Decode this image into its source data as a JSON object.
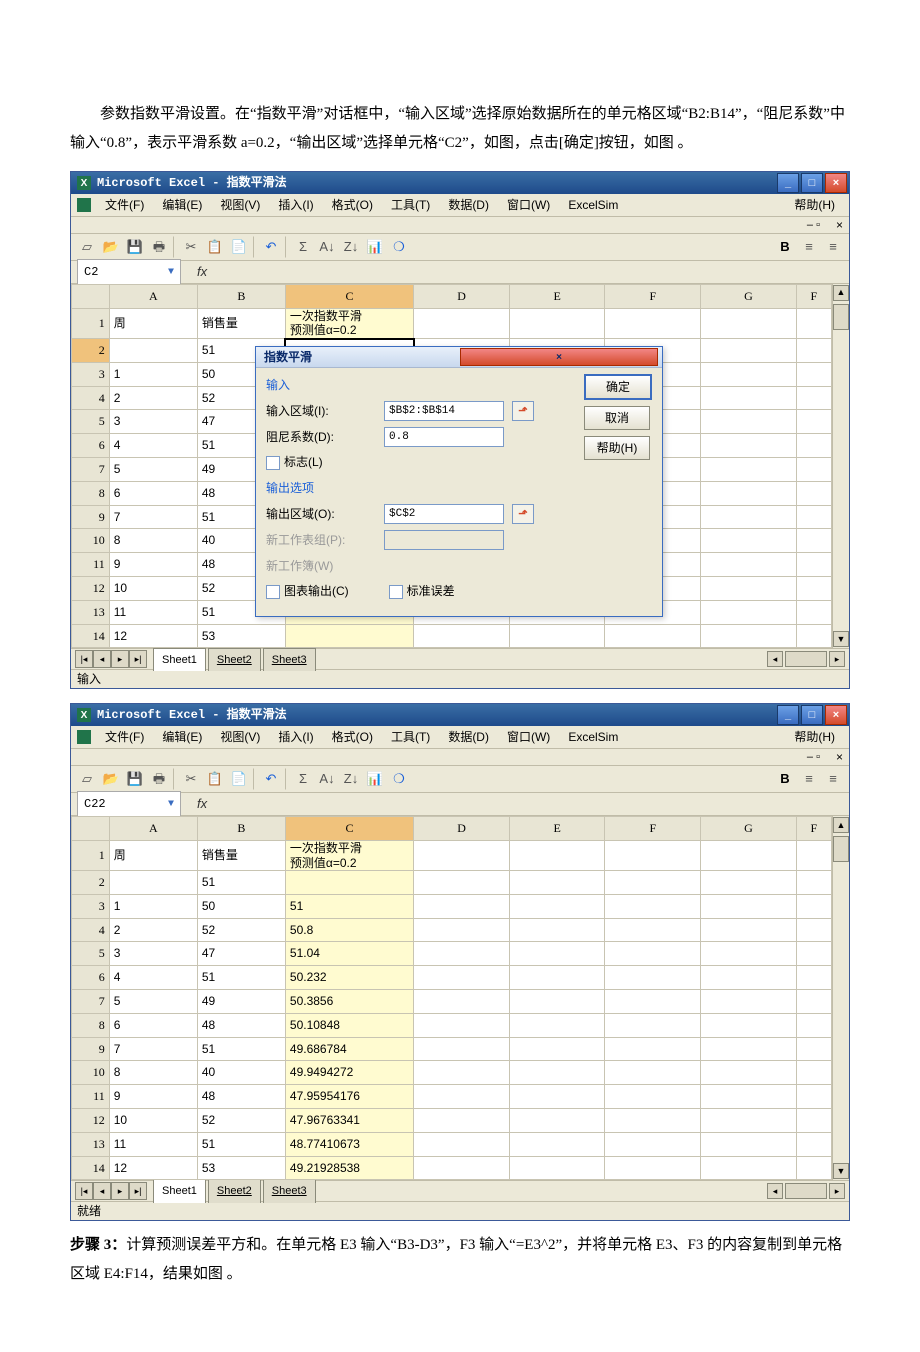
{
  "intro": {
    "p1": "参数指数平滑设置。在“指数平滑”对话框中，“输入区域”选择原始数据所在的单元格区域“B2:B14”，“阻尼系数”中输入“0.8”，表示平滑系数 a=0.2，“输出区域”选择单元格“C2”，如图，点击[确定]按钮，如图 。"
  },
  "step3": {
    "label": "步骤 3：",
    "text": "计算预测误差平方和。在单元格 E3 输入“B3-D3”，F3 输入“=E3^2”，并将单元格 E3、F3 的内容复制到单元格区域 E4:F14，结果如图 。"
  },
  "win": {
    "title": "Microsoft Excel - 指数平滑法",
    "menus": [
      "文件(F)",
      "编辑(E)",
      "视图(V)",
      "插入(I)",
      "格式(O)",
      "工具(T)",
      "数据(D)",
      "窗口(W)",
      "ExcelSim",
      "帮助(H)"
    ],
    "min": "_",
    "max": "□",
    "close": "×",
    "subclose": "×",
    "status_input": "输入",
    "status_ready": "就绪",
    "tabs": [
      "Sheet1",
      "Sheet2",
      "Sheet3"
    ]
  },
  "grid1": {
    "cellref": "C2",
    "cols": [
      "A",
      "B",
      "C",
      "D",
      "E",
      "F",
      "G",
      "F"
    ],
    "header_row": {
      "a": "周",
      "b": "销售量",
      "c1": "一次指数平滑",
      "c2": "预测值α=0.2"
    },
    "rows": [
      {
        "n": "1",
        "a": "",
        "b": ""
      },
      {
        "n": "2",
        "a": "",
        "b": "51"
      },
      {
        "n": "3",
        "a": "1",
        "b": "50"
      },
      {
        "n": "4",
        "a": "2",
        "b": "52"
      },
      {
        "n": "5",
        "a": "3",
        "b": "47"
      },
      {
        "n": "6",
        "a": "4",
        "b": "51"
      },
      {
        "n": "7",
        "a": "5",
        "b": "49"
      },
      {
        "n": "8",
        "a": "6",
        "b": "48"
      },
      {
        "n": "9",
        "a": "7",
        "b": "51"
      },
      {
        "n": "10",
        "a": "8",
        "b": "40"
      },
      {
        "n": "11",
        "a": "9",
        "b": "48"
      },
      {
        "n": "12",
        "a": "10",
        "b": "52"
      },
      {
        "n": "13",
        "a": "11",
        "b": "51"
      },
      {
        "n": "14",
        "a": "12",
        "b": "53"
      }
    ]
  },
  "dialog": {
    "title": "指数平滑",
    "grp_in": "输入",
    "lbl_in_range": "输入区域(I):",
    "val_in_range": "$B$2:$B$14",
    "lbl_damp": "阻尼系数(D):",
    "val_damp": "0.8",
    "lbl_flag": "标志(L)",
    "grp_out": "输出选项",
    "lbl_out_range": "输出区域(O):",
    "val_out_range": "$C$2",
    "lbl_new_sheet": "新工作表组(P):",
    "lbl_new_book": "新工作簿(W)",
    "lbl_chart": "图表输出(C)",
    "lbl_stderr": "标准误差",
    "btn_ok": "确定",
    "btn_cancel": "取消",
    "btn_help": "帮助(H)"
  },
  "grid2": {
    "cellref": "C22",
    "cols": [
      "A",
      "B",
      "C",
      "D",
      "E",
      "F",
      "G",
      "F"
    ],
    "header_row": {
      "a": "周",
      "b": "销售量",
      "c1": "一次指数平滑",
      "c2": "预测值α=0.2"
    },
    "rows": [
      {
        "n": "1",
        "a": "",
        "b": "",
        "c": ""
      },
      {
        "n": "2",
        "a": "",
        "b": "51",
        "c": ""
      },
      {
        "n": "3",
        "a": "1",
        "b": "50",
        "c": "51"
      },
      {
        "n": "4",
        "a": "2",
        "b": "52",
        "c": "50.8"
      },
      {
        "n": "5",
        "a": "3",
        "b": "47",
        "c": "51.04"
      },
      {
        "n": "6",
        "a": "4",
        "b": "51",
        "c": "50.232"
      },
      {
        "n": "7",
        "a": "5",
        "b": "49",
        "c": "50.3856"
      },
      {
        "n": "8",
        "a": "6",
        "b": "48",
        "c": "50.10848"
      },
      {
        "n": "9",
        "a": "7",
        "b": "51",
        "c": "49.686784"
      },
      {
        "n": "10",
        "a": "8",
        "b": "40",
        "c": "49.9494272"
      },
      {
        "n": "11",
        "a": "9",
        "b": "48",
        "c": "47.95954176"
      },
      {
        "n": "12",
        "a": "10",
        "b": "52",
        "c": "47.96763341"
      },
      {
        "n": "13",
        "a": "11",
        "b": "51",
        "c": "48.77410673"
      },
      {
        "n": "14",
        "a": "12",
        "b": "53",
        "c": "49.21928538"
      }
    ]
  }
}
